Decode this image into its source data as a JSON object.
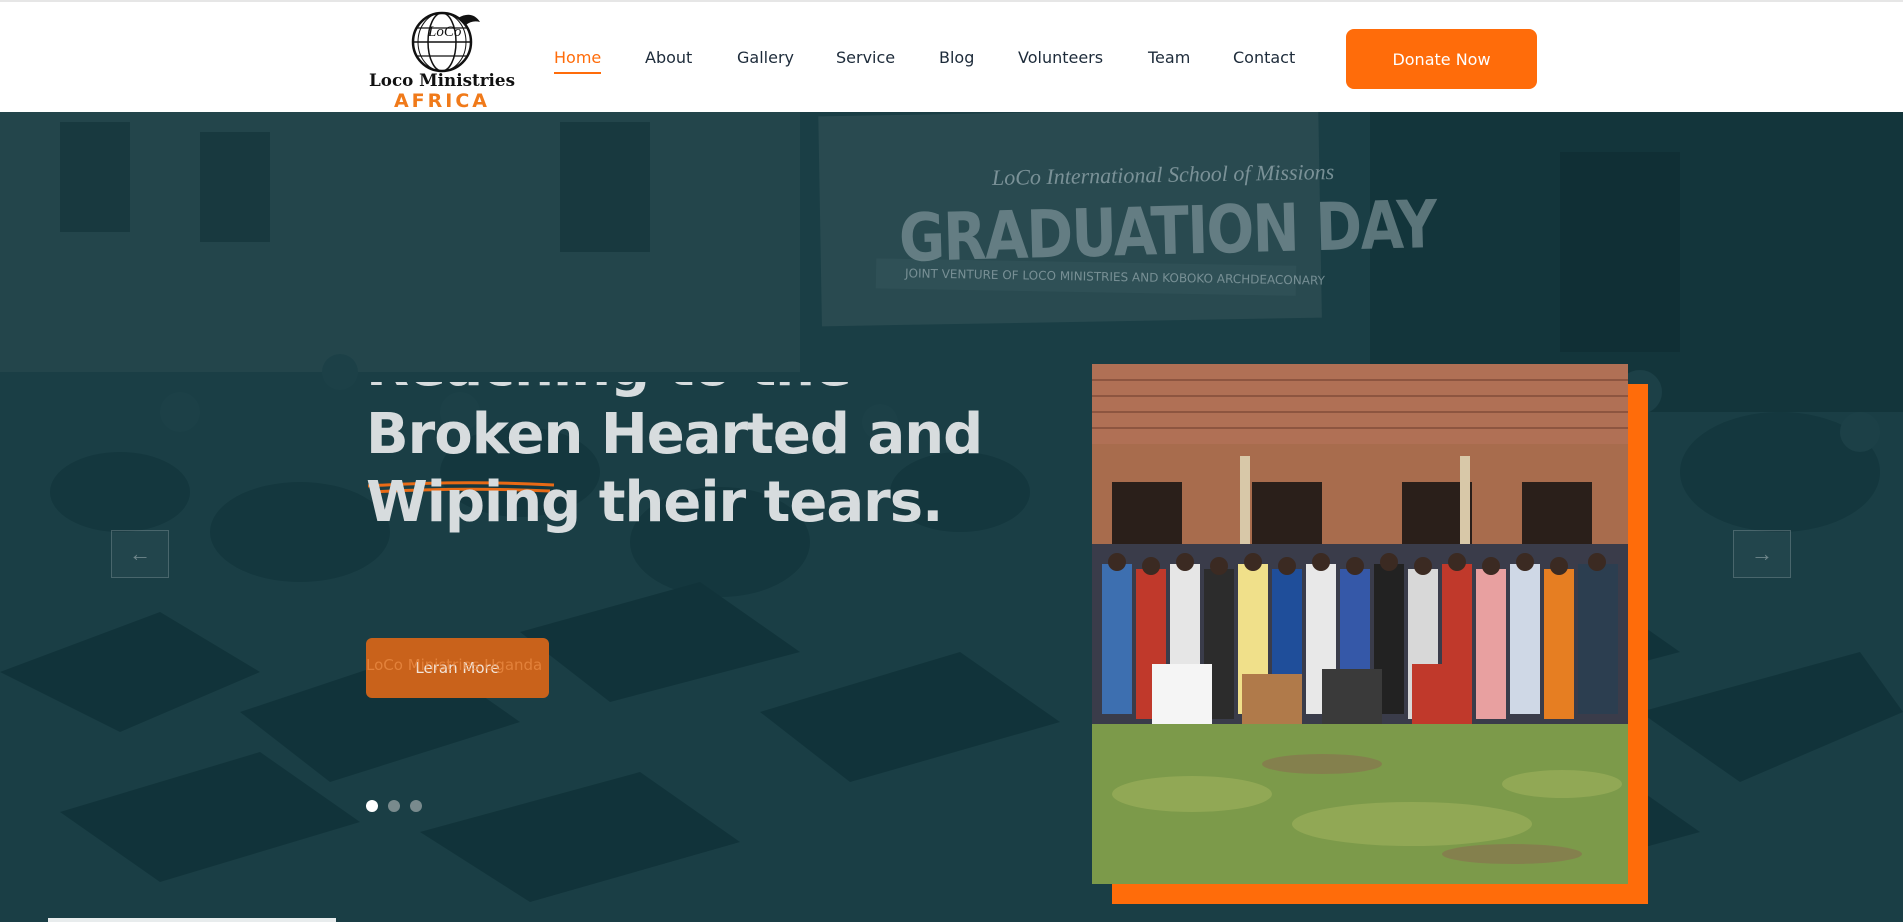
{
  "brand": {
    "logo_alt": "Loco Ministries Africa logo",
    "logo_top": "LoCo",
    "logo_name": "Loco Ministries",
    "logo_region": "AFRICA"
  },
  "nav": {
    "items": [
      {
        "label": "Home",
        "active": true
      },
      {
        "label": "About",
        "active": false
      },
      {
        "label": "Gallery",
        "active": false
      },
      {
        "label": "Service",
        "active": false
      },
      {
        "label": "Blog",
        "active": false
      },
      {
        "label": "Volunteers",
        "active": false
      },
      {
        "label": "Team",
        "active": false
      },
      {
        "label": "Contact",
        "active": false
      }
    ],
    "donate_label": "Donate Now"
  },
  "hero": {
    "banner_line_1": "LoCo International School of Missions",
    "banner_line_2": "GRADUATION DAY",
    "banner_line_3": "JOINT VENTURE OF LOCO MINISTRIES AND KOBOKO ARCHDEACONARY",
    "headline_partial": "Reaching to the",
    "headline_highlight": "Broken",
    "headline_rest": " Hearted and",
    "headline_line_3": "Wiping their tears.",
    "cta_label": "Leran More",
    "ghost_caption": "LoCo Ministries Uganda",
    "slides_total": 3,
    "active_slide": 1,
    "prev_arrow": "←",
    "next_arrow": "→"
  },
  "colors": {
    "accent": "#ff6c0a",
    "nav_text": "#1d2b3a",
    "hero_overlay": "#0c343c",
    "headline": "#d7dcde"
  },
  "icons": {
    "prev": "arrow-left-icon",
    "next": "arrow-right-icon"
  }
}
